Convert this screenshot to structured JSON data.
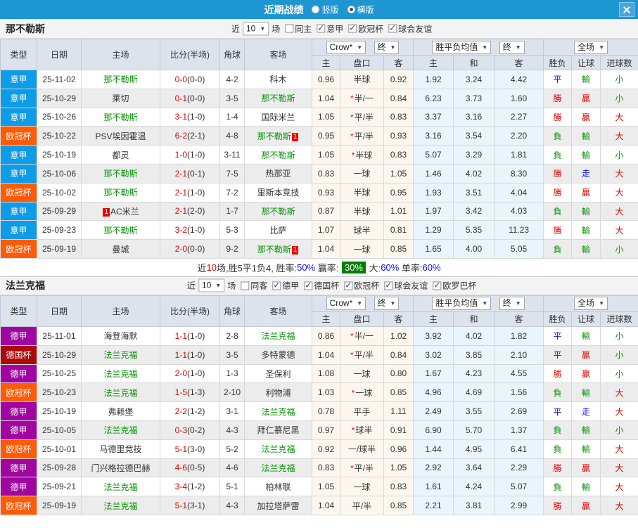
{
  "titlebar": {
    "title": "近期战绩",
    "radios": [
      {
        "label": "竖版",
        "selected": false
      },
      {
        "label": "横版",
        "selected": true
      }
    ]
  },
  "header": {
    "cols": {
      "type": "类型",
      "date": "日期",
      "home": "主场",
      "score": "比分(半场)",
      "corner": "角球",
      "away": "客场",
      "odds_home": "主",
      "handicap": "盘口",
      "odds_away": "客",
      "avg_home": "主",
      "avg_draw": "和",
      "avg_away": "客",
      "result": "胜负",
      "let_goal": "让球",
      "goals": "进球数"
    },
    "selects": {
      "crown": "Crow*",
      "final1": "终",
      "avg": "胜平负均值",
      "final2": "终",
      "full": "全场"
    }
  },
  "league_colors": {
    "意甲": "#0e9be8",
    "欧冠杯": "#ff5a05",
    "德甲": "#a105a1",
    "德国杯": "#ab0a0a"
  },
  "sections": [
    {
      "team": "那不勒斯",
      "filter": {
        "near": "近",
        "count": "10",
        "games": "场",
        "checkboxes": [
          {
            "label": "同主",
            "checked": false
          },
          {
            "label": "意甲",
            "checked": true
          },
          {
            "label": "欧冠杯",
            "checked": true
          },
          {
            "label": "球会友谊",
            "checked": true
          }
        ]
      },
      "rows": [
        {
          "league": "意甲",
          "date": "25-11-02",
          "home": "那不勒斯",
          "home_hl": true,
          "score": "0-0",
          "half": "(0-0)",
          "corner": "4-2",
          "away": "科木",
          "away_hl": false,
          "o1": "0.96",
          "star": false,
          "hcap": "半球",
          "o2": "0.92",
          "a1": "1.92",
          "a2": "3.24",
          "a3": "4.42",
          "r1": {
            "t": "平",
            "c": "blue"
          },
          "r2": {
            "t": "輸",
            "c": "green"
          },
          "r3": {
            "t": "小",
            "c": "green"
          }
        },
        {
          "league": "意甲",
          "date": "25-10-29",
          "home": "莱切",
          "home_hl": false,
          "score": "0-1",
          "half": "(0-0)",
          "corner": "3-5",
          "away": "那不勒斯",
          "away_hl": true,
          "o1": "1.04",
          "star": true,
          "hcap": "半/一",
          "o2": "0.84",
          "a1": "6.23",
          "a2": "3.73",
          "a3": "1.60",
          "r1": {
            "t": "勝",
            "c": "red"
          },
          "r2": {
            "t": "贏",
            "c": "red"
          },
          "r3": {
            "t": "小",
            "c": "green"
          }
        },
        {
          "league": "意甲",
          "date": "25-10-26",
          "home": "那不勒斯",
          "home_hl": true,
          "score": "3-1",
          "half": "(1-0)",
          "corner": "1-4",
          "away": "国际米兰",
          "away_hl": false,
          "o1": "1.05",
          "star": true,
          "hcap": "平/半",
          "o2": "0.83",
          "a1": "3.37",
          "a2": "3.16",
          "a3": "2.27",
          "r1": {
            "t": "勝",
            "c": "red"
          },
          "r2": {
            "t": "贏",
            "c": "red"
          },
          "r3": {
            "t": "大",
            "c": "red"
          }
        },
        {
          "league": "欧冠杯",
          "date": "25-10-22",
          "home": "PSV埃因霍温",
          "home_hl": false,
          "score": "6-2",
          "half": "(2-1)",
          "corner": "4-8",
          "away": "那不勒斯",
          "away_hl": true,
          "away_suf": "1",
          "o1": "0.95",
          "star": true,
          "hcap": "平/半",
          "o2": "0.93",
          "a1": "3.16",
          "a2": "3.54",
          "a3": "2.20",
          "r1": {
            "t": "負",
            "c": "green"
          },
          "r2": {
            "t": "輸",
            "c": "green"
          },
          "r3": {
            "t": "大",
            "c": "red"
          }
        },
        {
          "league": "意甲",
          "date": "25-10-19",
          "home": "都灵",
          "home_hl": false,
          "score": "1-0",
          "half": "(1-0)",
          "corner": "3-11",
          "away": "那不勒斯",
          "away_hl": true,
          "o1": "1.05",
          "star": true,
          "hcap": "半球",
          "o2": "0.83",
          "a1": "5.07",
          "a2": "3.29",
          "a3": "1.81",
          "r1": {
            "t": "負",
            "c": "green"
          },
          "r2": {
            "t": "輸",
            "c": "green"
          },
          "r3": {
            "t": "小",
            "c": "green"
          }
        },
        {
          "league": "意甲",
          "date": "25-10-06",
          "home": "那不勒斯",
          "home_hl": true,
          "score": "2-1",
          "half": "(0-1)",
          "corner": "7-5",
          "away": "热那亚",
          "away_hl": false,
          "o1": "0.83",
          "star": false,
          "hcap": "一球",
          "o2": "1.05",
          "a1": "1.46",
          "a2": "4.02",
          "a3": "8.30",
          "r1": {
            "t": "勝",
            "c": "red"
          },
          "r2": {
            "t": "走",
            "c": "blue"
          },
          "r3": {
            "t": "大",
            "c": "red"
          }
        },
        {
          "league": "欧冠杯",
          "date": "25-10-02",
          "home": "那不勒斯",
          "home_hl": true,
          "score": "2-1",
          "half": "(1-0)",
          "corner": "7-2",
          "away": "里斯本竞技",
          "away_hl": false,
          "o1": "0.93",
          "star": false,
          "hcap": "半球",
          "o2": "0.95",
          "a1": "1.93",
          "a2": "3.51",
          "a3": "4.04",
          "r1": {
            "t": "勝",
            "c": "red"
          },
          "r2": {
            "t": "贏",
            "c": "red"
          },
          "r3": {
            "t": "大",
            "c": "red"
          }
        },
        {
          "league": "意甲",
          "date": "25-09-29",
          "home": "AC米兰",
          "home_hl": false,
          "home_pre": "1",
          "score": "2-1",
          "half": "(2-0)",
          "corner": "1-7",
          "away": "那不勒斯",
          "away_hl": true,
          "o1": "0.87",
          "star": false,
          "hcap": "半球",
          "o2": "1.01",
          "a1": "1.97",
          "a2": "3.42",
          "a3": "4.03",
          "r1": {
            "t": "負",
            "c": "green"
          },
          "r2": {
            "t": "輸",
            "c": "green"
          },
          "r3": {
            "t": "大",
            "c": "red"
          }
        },
        {
          "league": "意甲",
          "date": "25-09-23",
          "home": "那不勒斯",
          "home_hl": true,
          "score": "3-2",
          "half": "(1-0)",
          "corner": "5-3",
          "away": "比萨",
          "away_hl": false,
          "o1": "1.07",
          "star": false,
          "hcap": "球半",
          "o2": "0.81",
          "a1": "1.29",
          "a2": "5.35",
          "a3": "11.23",
          "r1": {
            "t": "勝",
            "c": "red"
          },
          "r2": {
            "t": "輸",
            "c": "green"
          },
          "r3": {
            "t": "大",
            "c": "red"
          }
        },
        {
          "league": "欧冠杯",
          "date": "25-09-19",
          "home": "曼城",
          "home_hl": false,
          "score": "2-0",
          "half": "(0-0)",
          "corner": "9-2",
          "away": "那不勒斯",
          "away_hl": true,
          "away_suf": "1",
          "o1": "1.04",
          "star": false,
          "hcap": "一球",
          "o2": "0.85",
          "a1": "1.65",
          "a2": "4.00",
          "a3": "5.05",
          "r1": {
            "t": "負",
            "c": "green"
          },
          "r2": {
            "t": "輸",
            "c": "green"
          },
          "r3": {
            "t": "小",
            "c": "green"
          }
        }
      ],
      "summary": [
        {
          "t": "近"
        },
        {
          "t": "10",
          "s": "red"
        },
        {
          "t": "场,胜5平1负4, 胜率:"
        },
        {
          "t": "50%",
          "s": "blue"
        },
        {
          "t": " 赢率: "
        },
        {
          "t": "30%",
          "s": "badge"
        },
        {
          "t": " 大:"
        },
        {
          "t": "60%",
          "s": "blue"
        },
        {
          "t": " 单率:"
        },
        {
          "t": "60%",
          "s": "blue"
        }
      ]
    },
    {
      "team": "法兰克福",
      "filter": {
        "near": "近",
        "count": "10",
        "games": "场",
        "checkboxes": [
          {
            "label": "同客",
            "checked": false
          },
          {
            "label": "德甲",
            "checked": true
          },
          {
            "label": "德国杯",
            "checked": true
          },
          {
            "label": "欧冠杯",
            "checked": true
          },
          {
            "label": "球会友谊",
            "checked": true
          },
          {
            "label": "欧罗巴杯",
            "checked": true
          }
        ]
      },
      "rows": [
        {
          "league": "德甲",
          "date": "25-11-01",
          "home": "海登海默",
          "home_hl": false,
          "score": "1-1",
          "half": "(1-0)",
          "corner": "2-8",
          "away": "法兰克福",
          "away_hl": true,
          "o1": "0.86",
          "star": true,
          "hcap": "半/一",
          "o2": "1.02",
          "a1": "3.92",
          "a2": "4.02",
          "a3": "1.82",
          "r1": {
            "t": "平",
            "c": "blue"
          },
          "r2": {
            "t": "輸",
            "c": "green"
          },
          "r3": {
            "t": "小",
            "c": "green"
          }
        },
        {
          "league": "德国杯",
          "date": "25-10-29",
          "home": "法兰克福",
          "home_hl": true,
          "score": "1-1",
          "half": "(1-0)",
          "corner": "3-5",
          "away": "多特蒙德",
          "away_hl": false,
          "o1": "1.04",
          "star": true,
          "hcap": "平/半",
          "o2": "0.84",
          "a1": "3.02",
          "a2": "3.85",
          "a3": "2.10",
          "r1": {
            "t": "平",
            "c": "blue"
          },
          "r2": {
            "t": "贏",
            "c": "red"
          },
          "r3": {
            "t": "小",
            "c": "green"
          }
        },
        {
          "league": "德甲",
          "date": "25-10-25",
          "home": "法兰克福",
          "home_hl": true,
          "score": "2-0",
          "half": "(1-0)",
          "corner": "1-3",
          "away": "圣保利",
          "away_hl": false,
          "o1": "1.08",
          "star": false,
          "hcap": "一球",
          "o2": "0.80",
          "a1": "1.67",
          "a2": "4.23",
          "a3": "4.55",
          "r1": {
            "t": "勝",
            "c": "red"
          },
          "r2": {
            "t": "贏",
            "c": "red"
          },
          "r3": {
            "t": "小",
            "c": "green"
          }
        },
        {
          "league": "欧冠杯",
          "date": "25-10-23",
          "home": "法兰克福",
          "home_hl": true,
          "score": "1-5",
          "half": "(1-3)",
          "corner": "2-10",
          "away": "利物浦",
          "away_hl": false,
          "o1": "1.03",
          "star": true,
          "hcap": "一球",
          "o2": "0.85",
          "a1": "4.96",
          "a2": "4.69",
          "a3": "1.56",
          "r1": {
            "t": "負",
            "c": "green"
          },
          "r2": {
            "t": "輸",
            "c": "green"
          },
          "r3": {
            "t": "大",
            "c": "red"
          }
        },
        {
          "league": "德甲",
          "date": "25-10-19",
          "home": "弗赖堡",
          "home_hl": false,
          "score": "2-2",
          "half": "(1-2)",
          "corner": "3-1",
          "away": "法兰克福",
          "away_hl": true,
          "o1": "0.78",
          "star": false,
          "hcap": "平手",
          "o2": "1.11",
          "a1": "2.49",
          "a2": "3.55",
          "a3": "2.69",
          "r1": {
            "t": "平",
            "c": "blue"
          },
          "r2": {
            "t": "走",
            "c": "blue"
          },
          "r3": {
            "t": "大",
            "c": "red"
          }
        },
        {
          "league": "德甲",
          "date": "25-10-05",
          "home": "法兰克福",
          "home_hl": true,
          "score": "0-3",
          "half": "(0-2)",
          "corner": "4-3",
          "away": "拜仁慕尼黑",
          "away_hl": false,
          "o1": "0.97",
          "star": true,
          "hcap": "球半",
          "o2": "0.91",
          "a1": "6.90",
          "a2": "5.70",
          "a3": "1.37",
          "r1": {
            "t": "負",
            "c": "green"
          },
          "r2": {
            "t": "輸",
            "c": "green"
          },
          "r3": {
            "t": "小",
            "c": "green"
          }
        },
        {
          "league": "欧冠杯",
          "date": "25-10-01",
          "home": "马德里竞技",
          "home_hl": false,
          "score": "5-1",
          "half": "(3-0)",
          "corner": "5-2",
          "away": "法兰克福",
          "away_hl": true,
          "o1": "0.92",
          "star": false,
          "hcap": "一/球半",
          "o2": "0.96",
          "a1": "1.44",
          "a2": "4.95",
          "a3": "6.41",
          "r1": {
            "t": "負",
            "c": "green"
          },
          "r2": {
            "t": "輸",
            "c": "green"
          },
          "r3": {
            "t": "大",
            "c": "red"
          }
        },
        {
          "league": "德甲",
          "date": "25-09-28",
          "home": "门兴格拉德巴赫",
          "home_hl": false,
          "score": "4-6",
          "half": "(0-5)",
          "corner": "4-6",
          "away": "法兰克福",
          "away_hl": true,
          "o1": "0.83",
          "star": true,
          "hcap": "平/半",
          "o2": "1.05",
          "a1": "2.92",
          "a2": "3.64",
          "a3": "2.29",
          "r1": {
            "t": "勝",
            "c": "red"
          },
          "r2": {
            "t": "贏",
            "c": "red"
          },
          "r3": {
            "t": "大",
            "c": "red"
          }
        },
        {
          "league": "德甲",
          "date": "25-09-21",
          "home": "法兰克福",
          "home_hl": true,
          "score": "3-4",
          "half": "(1-2)",
          "corner": "5-1",
          "away": "柏林联",
          "away_hl": false,
          "o1": "1.05",
          "star": false,
          "hcap": "一球",
          "o2": "0.83",
          "a1": "1.61",
          "a2": "4.24",
          "a3": "5.07",
          "r1": {
            "t": "負",
            "c": "green"
          },
          "r2": {
            "t": "輸",
            "c": "green"
          },
          "r3": {
            "t": "大",
            "c": "red"
          }
        },
        {
          "league": "欧冠杯",
          "date": "25-09-19",
          "home": "法兰克福",
          "home_hl": true,
          "score": "5-1",
          "half": "(3-1)",
          "corner": "4-3",
          "away": "加拉塔萨雷",
          "away_hl": false,
          "o1": "1.04",
          "star": false,
          "hcap": "平/半",
          "o2": "0.85",
          "a1": "2.21",
          "a2": "3.81",
          "a3": "2.99",
          "r1": {
            "t": "勝",
            "c": "red"
          },
          "r2": {
            "t": "贏",
            "c": "red"
          },
          "r3": {
            "t": "大",
            "c": "red"
          }
        }
      ]
    }
  ]
}
